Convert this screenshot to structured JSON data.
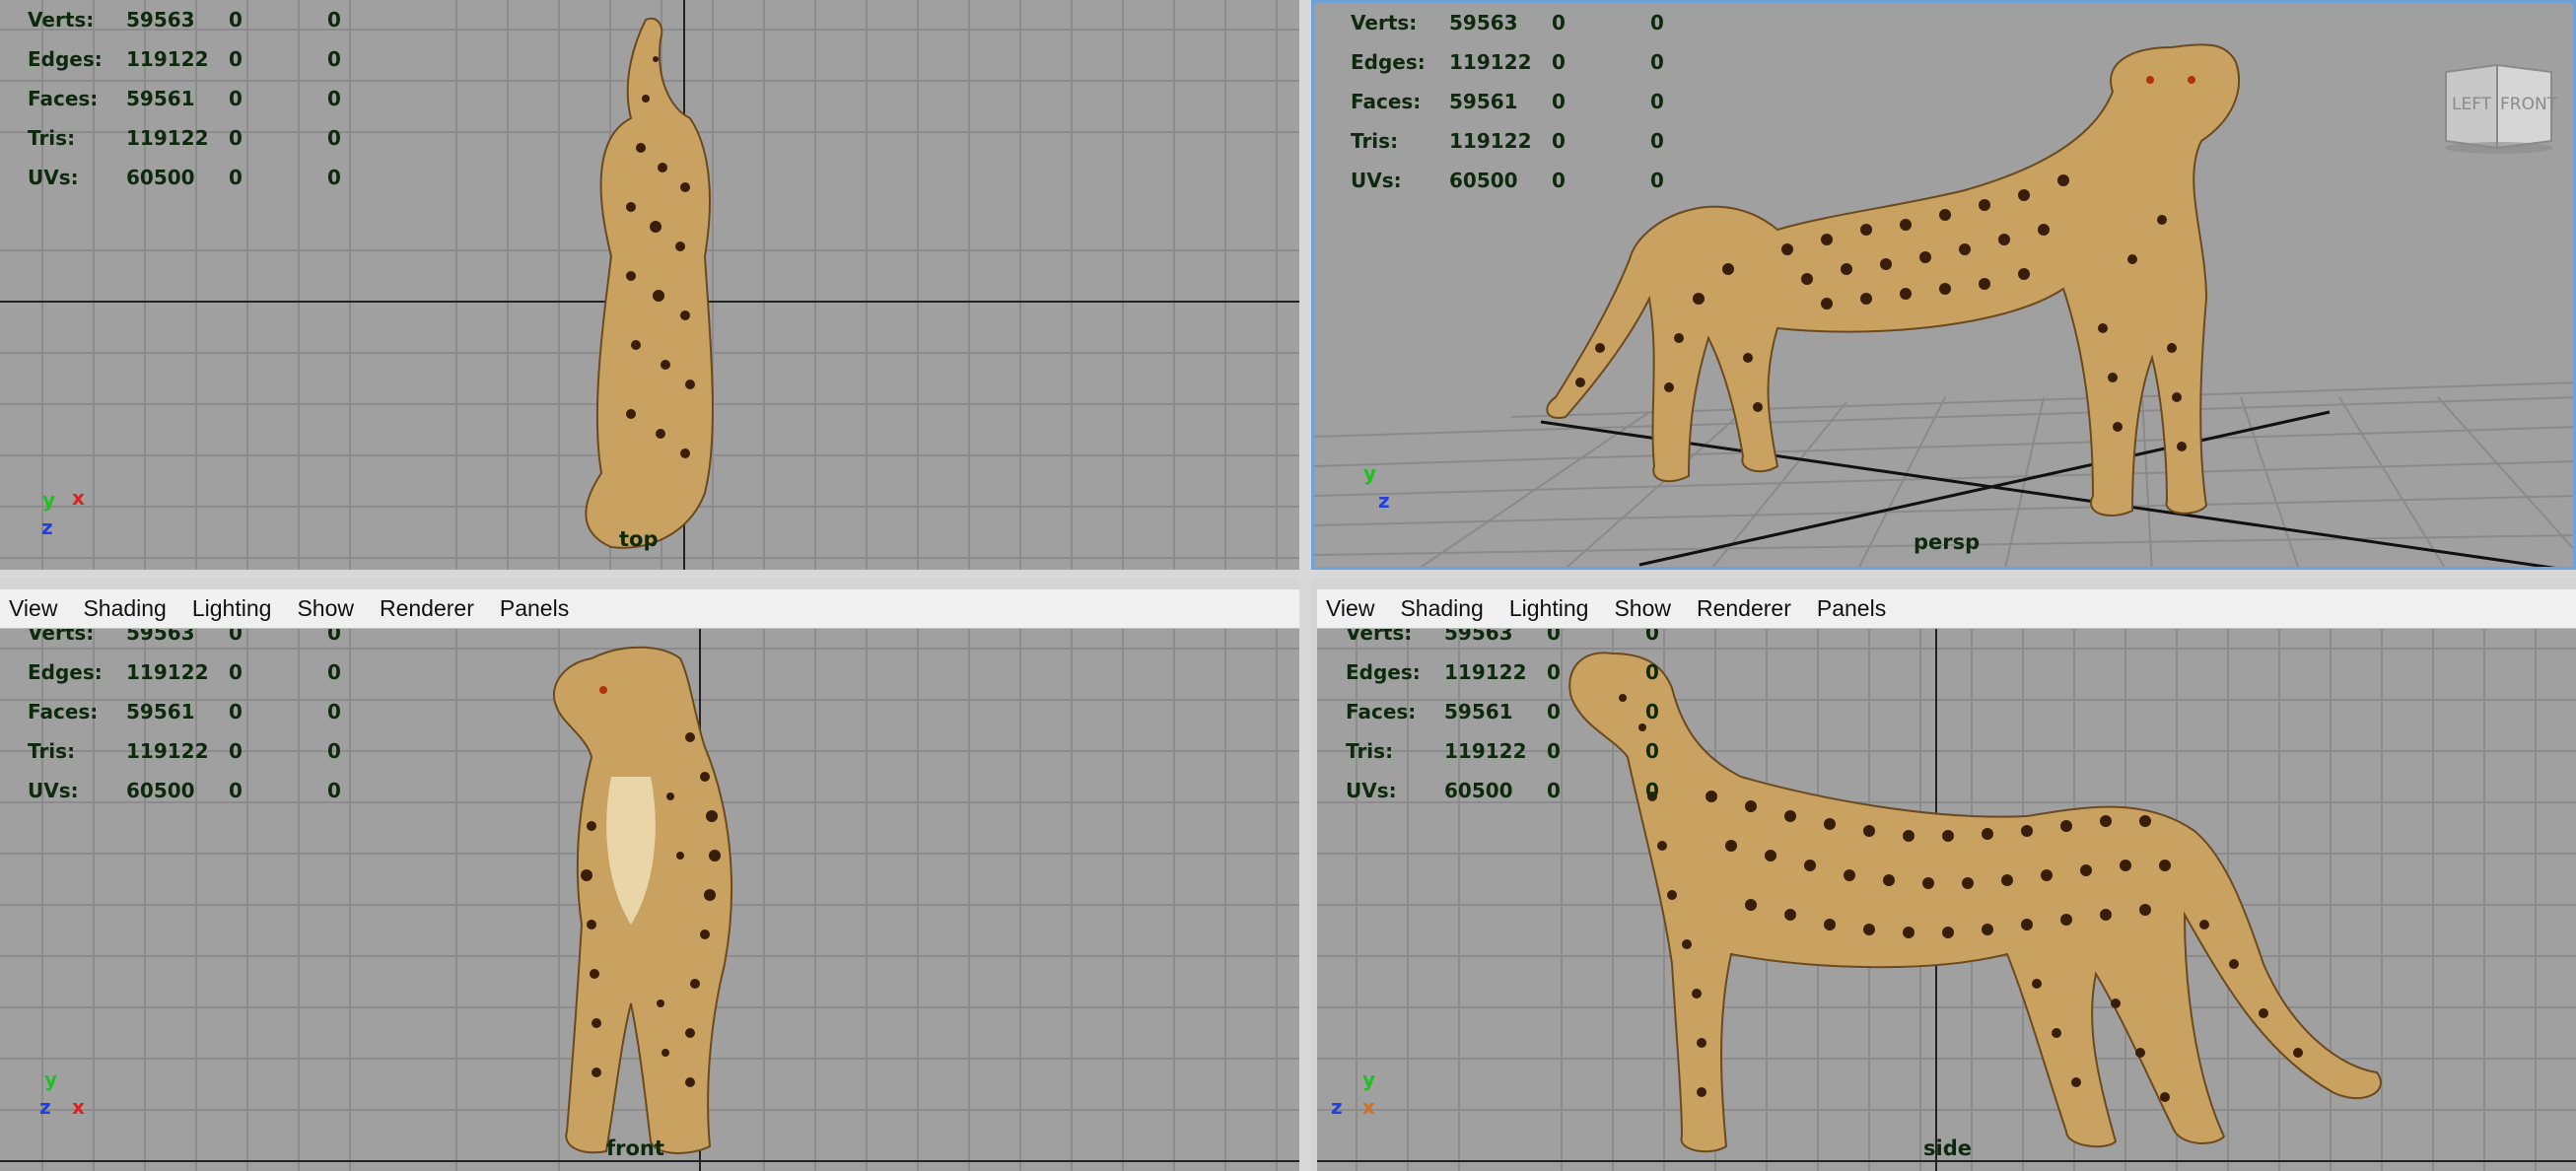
{
  "stats": [
    {
      "label": "Verts:",
      "v1": "59563",
      "v2": "0",
      "v3": "0"
    },
    {
      "label": "Edges:",
      "v1": "119122",
      "v2": "0",
      "v3": "0"
    },
    {
      "label": "Faces:",
      "v1": "59561",
      "v2": "0",
      "v3": "0"
    },
    {
      "label": "Tris:",
      "v1": "119122",
      "v2": "0",
      "v3": "0"
    },
    {
      "label": "UVs:",
      "v1": "60500",
      "v2": "0",
      "v3": "0"
    }
  ],
  "menu": [
    "View",
    "Shading",
    "Lighting",
    "Show",
    "Renderer",
    "Panels"
  ],
  "viewports": {
    "top": {
      "label": "top",
      "axes": [
        "y",
        "x",
        "z"
      ]
    },
    "persp": {
      "label": "persp",
      "axes": [
        "y",
        "z"
      ],
      "viewcube": {
        "left": "LEFT",
        "front": "FRONT"
      }
    },
    "front": {
      "label": "front",
      "axes": [
        "y",
        "z",
        "x"
      ]
    },
    "side": {
      "label": "side",
      "axes": [
        "y",
        "z",
        "x"
      ]
    }
  },
  "colors": {
    "viewport_bg": "#a0a0a0",
    "grid": "#8a8a8a",
    "hud_text": "#0d2a0d",
    "axis_x": "#e02020",
    "axis_y": "#20c020",
    "axis_z": "#2040e0",
    "fur": "#c9a160",
    "spot": "#3a1e0c"
  }
}
